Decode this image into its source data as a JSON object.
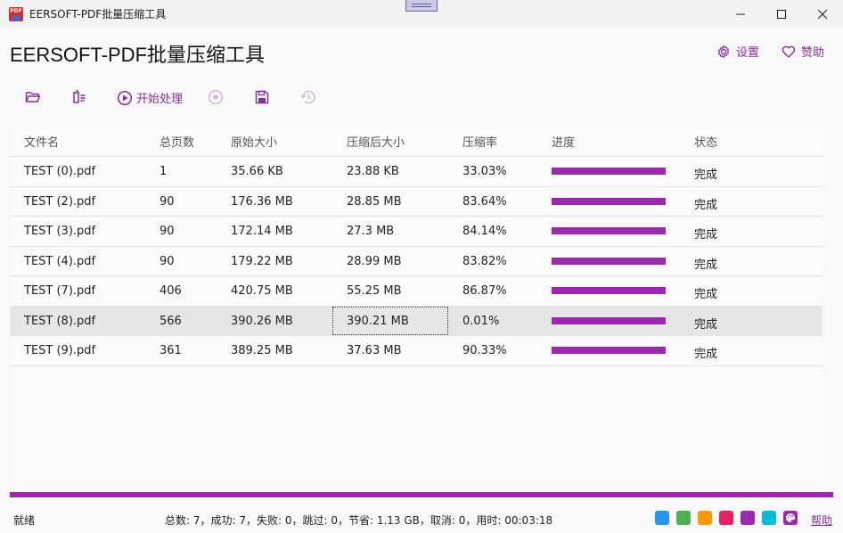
{
  "window": {
    "title": "EERSOFT-PDF批量压缩工具",
    "icon_text": "PDF"
  },
  "header": {
    "title": "EERSOFT-PDF批量压缩工具",
    "settings_label": "设置",
    "donate_label": "赞助"
  },
  "toolbar": {
    "start_label": "开始处理"
  },
  "table": {
    "columns": [
      "文件名",
      "总页数",
      "原始大小",
      "压缩后大小",
      "压缩率",
      "进度",
      "状态"
    ],
    "rows": [
      {
        "name": "TEST (0).pdf",
        "pages": "1",
        "orig": "35.66 KB",
        "comp": "23.88 KB",
        "ratio": "33.03%",
        "progress": 1.0,
        "status": "完成"
      },
      {
        "name": "TEST (2).pdf",
        "pages": "90",
        "orig": "176.36 MB",
        "comp": "28.85 MB",
        "ratio": "83.64%",
        "progress": 1.0,
        "status": "完成"
      },
      {
        "name": "TEST (3).pdf",
        "pages": "90",
        "orig": "172.14 MB",
        "comp": "27.3 MB",
        "ratio": "84.14%",
        "progress": 1.0,
        "status": "完成"
      },
      {
        "name": "TEST (4).pdf",
        "pages": "90",
        "orig": "179.22 MB",
        "comp": "28.99 MB",
        "ratio": "83.82%",
        "progress": 1.0,
        "status": "完成"
      },
      {
        "name": "TEST (7).pdf",
        "pages": "406",
        "orig": "420.75 MB",
        "comp": "55.25 MB",
        "ratio": "86.87%",
        "progress": 1.0,
        "status": "完成"
      },
      {
        "name": "TEST (8).pdf",
        "pages": "566",
        "orig": "390.26 MB",
        "comp": "390.21 MB",
        "ratio": "0.01%",
        "progress": 1.0,
        "status": "完成"
      },
      {
        "name": "TEST (9).pdf",
        "pages": "361",
        "orig": "389.25 MB",
        "comp": "37.63 MB",
        "ratio": "90.33%",
        "progress": 1.0,
        "status": "完成"
      }
    ],
    "selected_row": 5
  },
  "overall_progress": 1.0,
  "status": {
    "ready": "就绪",
    "summary": "总数: 7，成功: 7，失败: 0，跳过: 0，节省: 1.13 GB，取消: 0，用时: 00:03:18",
    "help": "帮助"
  },
  "theme_colors": [
    "#2196f3",
    "#4caf50",
    "#ff9800",
    "#e91e63",
    "#9c27b0",
    "#00bcd4"
  ],
  "accent": "#9c27b0"
}
